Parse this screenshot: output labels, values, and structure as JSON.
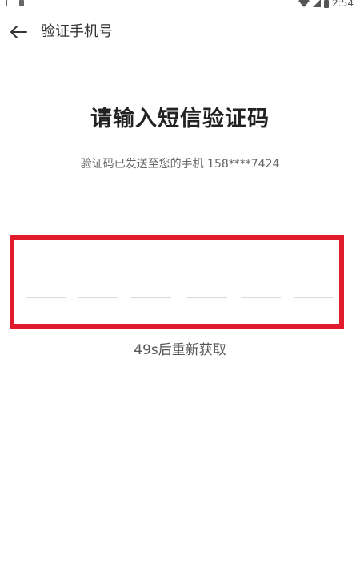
{
  "status_bar": {
    "time": "2:54"
  },
  "header": {
    "back_icon": "arrow-left-icon",
    "title": "验证手机号"
  },
  "main": {
    "title": "请输入短信验证码",
    "subtitle": "验证码已发送至您的手机 158****7424",
    "code_slots": [
      "",
      "",
      "",
      "",
      "",
      ""
    ],
    "resend_text": "49s后重新获取"
  },
  "colors": {
    "highlight_border": "#e21b2c",
    "slot_line": "#dcdcdc"
  }
}
